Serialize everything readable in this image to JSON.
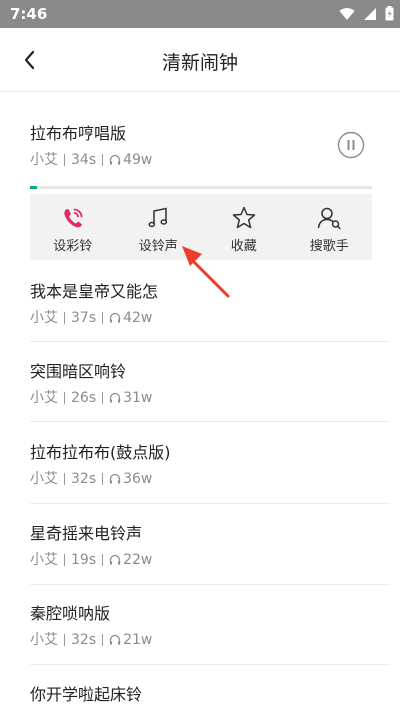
{
  "status_bar": {
    "time": "7:46"
  },
  "header": {
    "title": "清新闹钟"
  },
  "current": {
    "name": "拉布布哼唱版",
    "artist": "小艾",
    "duration": "34s",
    "plays": "49w",
    "progress_percent": 2
  },
  "actions": [
    {
      "label": "设彩铃",
      "icon": "phone-ring-icon"
    },
    {
      "label": "设铃声",
      "icon": "music-note-icon"
    },
    {
      "label": "收藏",
      "icon": "star-icon"
    },
    {
      "label": "搜歌手",
      "icon": "person-search-icon"
    }
  ],
  "songs": [
    {
      "name": "我本是皇帝又能怎",
      "artist": "小艾",
      "duration": "37s",
      "plays": "42w"
    },
    {
      "name": "突围暗区响铃",
      "artist": "小艾",
      "duration": "26s",
      "plays": "31w"
    },
    {
      "name": "拉布拉布布(鼓点版)",
      "artist": "小艾",
      "duration": "32s",
      "plays": "36w"
    },
    {
      "name": "星奇摇来电铃声",
      "artist": "小艾",
      "duration": "19s",
      "plays": "22w"
    },
    {
      "name": "秦腔唢呐版",
      "artist": "小艾",
      "duration": "32s",
      "plays": "21w"
    },
    {
      "name": "你开学啦起床铃"
    }
  ],
  "colors": {
    "accent": "#1aa38a",
    "phone_icon": "#e4286a",
    "arrow": "#ef3b2c"
  }
}
